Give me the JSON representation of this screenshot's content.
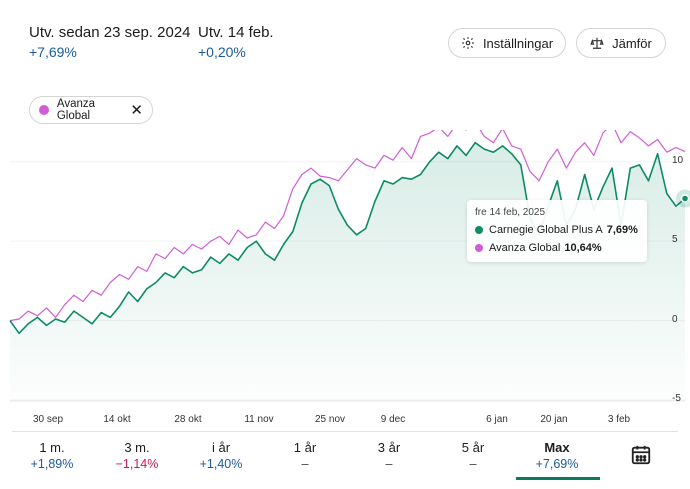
{
  "header": {
    "since_label": "Utv. sedan 23 sep. 2024",
    "since_value": "+7,69%",
    "day_label": "Utv. 14 feb.",
    "day_value": "+0,20%"
  },
  "buttons": {
    "settings_label": "Inställningar",
    "compare_label": "Jämför"
  },
  "chip": {
    "label": "Avanza Global",
    "color": "#cf5ed6"
  },
  "colors": {
    "primary": "#0d8a66",
    "compare": "#cf5ed6",
    "positive": "#1a5a9c",
    "negative": "#c2185b"
  },
  "tooltip": {
    "date": "fre 14 feb, 2025",
    "series1_name": "Carnegie Global Plus A",
    "series1_value": "7,69%",
    "series2_name": "Avanza Global",
    "series2_value": "10,64%"
  },
  "chart_data": {
    "type": "line",
    "xlabel": "",
    "ylabel": "",
    "ylim": [
      -5,
      12
    ],
    "x_ticks": [
      "30 sep",
      "14 okt",
      "28 okt",
      "11 nov",
      "25 nov",
      "9 dec",
      "6 jan",
      "20 jan",
      "3 feb"
    ],
    "y_ticks": [
      "10",
      "5",
      "0",
      "-5"
    ],
    "series": [
      {
        "name": "Carnegie Global Plus A",
        "color": "#0d8a66",
        "values": [
          0,
          -0.8,
          -0.2,
          0.2,
          -0.3,
          0.1,
          -0.1,
          0.6,
          0.2,
          -0.2,
          0.5,
          0.2,
          0.9,
          1.8,
          1.2,
          2.0,
          2.4,
          3.0,
          2.7,
          3.4,
          3.0,
          3.2,
          4.0,
          3.6,
          4.2,
          3.8,
          4.6,
          5.0,
          4.2,
          3.8,
          4.8,
          5.6,
          7.4,
          8.6,
          8.9,
          8.5,
          7.0,
          6.0,
          5.4,
          5.8,
          7.5,
          8.8,
          8.6,
          9.0,
          8.9,
          9.2,
          10.0,
          10.6,
          10.2,
          11.0,
          10.4,
          11.2,
          10.8,
          10.6,
          11.0,
          10.5,
          9.8,
          6.5,
          5.4,
          7.2,
          8.8,
          6.0,
          7.0,
          9.2,
          7.0,
          8.4,
          9.6,
          6.0,
          9.6,
          9.8,
          8.8,
          10.5,
          8.0,
          7.2,
          7.69
        ]
      },
      {
        "name": "Avanza Global",
        "color": "#cf5ed6",
        "values": [
          0,
          0.1,
          0.6,
          0.3,
          0.8,
          0.2,
          1.0,
          1.6,
          1.2,
          1.9,
          1.6,
          2.4,
          2.9,
          2.6,
          3.4,
          3.1,
          4.2,
          3.9,
          4.6,
          4.2,
          4.8,
          4.5,
          5.0,
          5.3,
          4.8,
          5.7,
          5.2,
          5.4,
          6.2,
          5.8,
          6.6,
          8.3,
          9.2,
          9.6,
          9.1,
          9.0,
          8.8,
          9.5,
          10.2,
          9.8,
          9.6,
          10.4,
          10.1,
          10.9,
          10.2,
          11.6,
          11.8,
          12.2,
          11.6,
          12.4,
          12.0,
          12.5,
          11.6,
          11.2,
          12.1,
          11.0,
          10.8,
          9.4,
          8.8,
          10.0,
          10.8,
          9.6,
          10.6,
          11.2,
          10.4,
          11.8,
          12.4,
          11.2,
          11.9,
          11.5,
          11.0,
          11.4,
          10.6,
          10.9,
          10.64
        ]
      }
    ]
  },
  "periods": [
    {
      "label": "1 m.",
      "value": "+1,89%",
      "tone": "positive"
    },
    {
      "label": "3 m.",
      "value": "−1,14%",
      "tone": "negative"
    },
    {
      "label": "i år",
      "value": "+1,40%",
      "tone": "positive"
    },
    {
      "label": "1 år",
      "value": "–",
      "tone": "neutral"
    },
    {
      "label": "3 år",
      "value": "–",
      "tone": "neutral"
    },
    {
      "label": "5 år",
      "value": "–",
      "tone": "neutral"
    },
    {
      "label": "Max",
      "value": "+7,69%",
      "tone": "positive",
      "active": true
    }
  ],
  "icons": {
    "settings": "gear-icon",
    "compare": "scale-icon",
    "calendar": "calendar-icon",
    "remove": "close-icon"
  }
}
